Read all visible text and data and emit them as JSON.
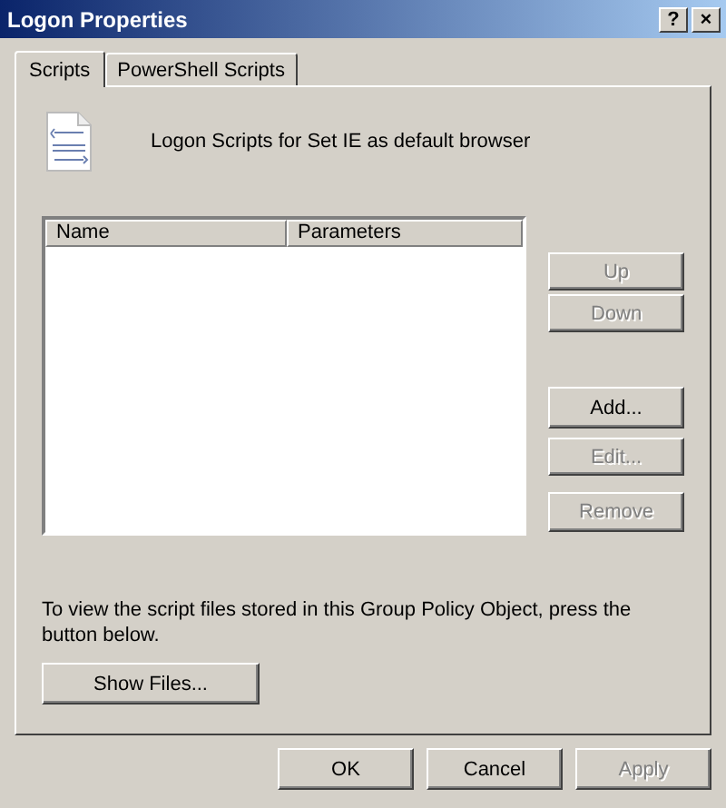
{
  "window": {
    "title": "Logon Properties",
    "title_buttons": [
      "?",
      "×"
    ]
  },
  "tabs": [
    {
      "label": "Scripts",
      "selected": true
    },
    {
      "label": "PowerShell Scripts",
      "selected": false
    }
  ],
  "heading": "Logon Scripts for Set IE as default browser",
  "table": {
    "columns": [
      "Name",
      "Parameters"
    ]
  },
  "side_buttons": [
    {
      "label": "Up",
      "disabled": true
    },
    {
      "label": "Down",
      "disabled": true
    },
    {
      "label": "Add...",
      "disabled": false
    },
    {
      "label": "Edit...",
      "disabled": true
    },
    {
      "label": "Remove",
      "disabled": true
    }
  ],
  "info": "To view the script files stored in this Group Policy Object, press the button below.",
  "show_files": "Show Files...",
  "buttons": [
    {
      "label": "OK",
      "disabled": false
    },
    {
      "label": "Cancel",
      "disabled": false
    },
    {
      "label": "Apply",
      "disabled": true
    }
  ]
}
